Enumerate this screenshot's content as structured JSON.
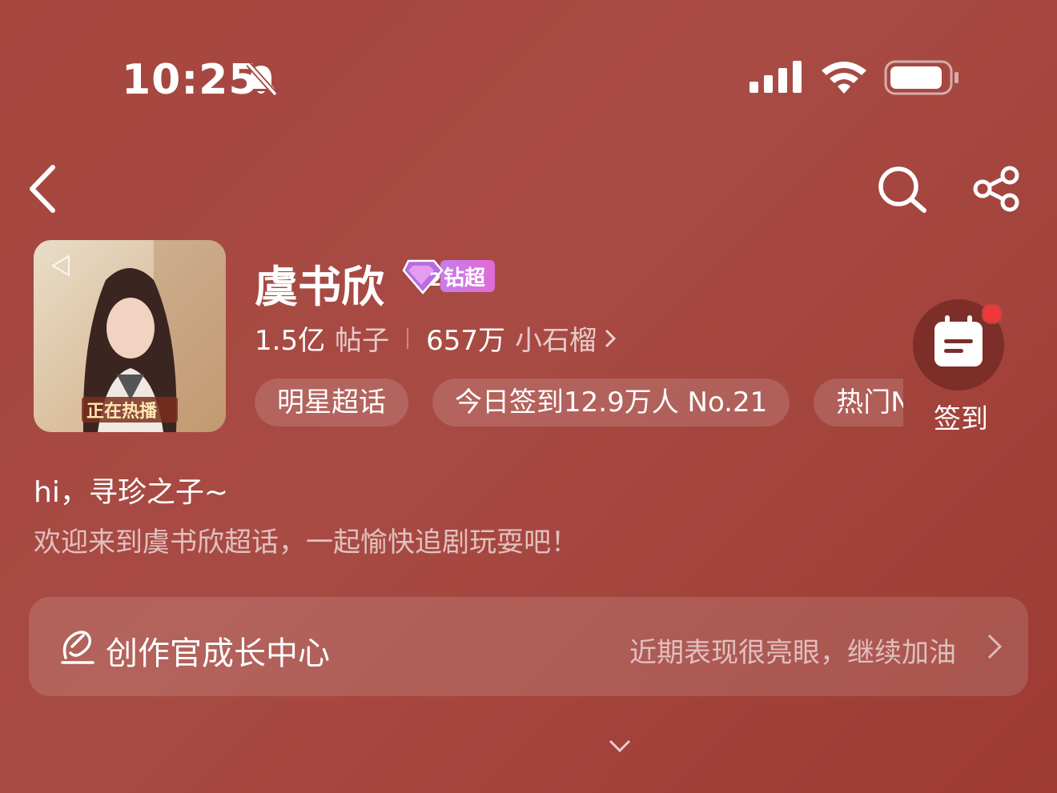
{
  "status_bar": {
    "time": "10:25",
    "icons": [
      "bell-slash-icon",
      "cellular-signal-icon",
      "wifi-icon",
      "battery-icon"
    ]
  },
  "nav": {
    "icons": [
      "back-icon",
      "search-icon",
      "share-icon"
    ]
  },
  "header": {
    "avatar_text": [
      "正在热播"
    ],
    "title": "虞书欣",
    "badge_level": "2",
    "badge_label": "钻超",
    "posts_count": "1.5亿",
    "posts_label": "帖子",
    "fans_count": "657万",
    "fans_label": "小石榴",
    "tags": [
      "明星超话",
      "今日签到12.9万人 No.21",
      "热门N"
    ],
    "signin_label": "签到"
  },
  "greeting": {
    "line1": "hi，寻珍之子~",
    "line2": "欢迎来到虞书欣超话，一起愉快追剧玩耍吧！"
  },
  "creator_card": {
    "title": "创作官成长中心",
    "subtitle": "近期表现很亮眼，继续加油"
  },
  "colors": {
    "background": "#a84b44",
    "badge": "#d77ae0",
    "notification_dot": "#f0373a"
  }
}
